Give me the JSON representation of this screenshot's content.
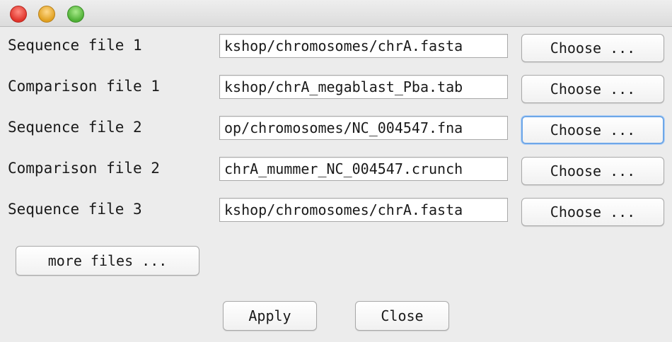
{
  "window": {
    "controls": [
      "close",
      "minimize",
      "zoom"
    ]
  },
  "rows": [
    {
      "label": "Sequence file 1",
      "path": "kshop/chromosomes/chrA.fasta",
      "button": "Choose ..."
    },
    {
      "label": "Comparison file 1",
      "path": "kshop/chrA_megablast_Pba.tab",
      "button": "Choose ..."
    },
    {
      "label": "Sequence file 2",
      "path": "op/chromosomes/NC_004547.fna",
      "button": "Choose ...",
      "focused": true
    },
    {
      "label": "Comparison file 2",
      "path": "chrA_mummer_NC_004547.crunch",
      "button": "Choose ..."
    },
    {
      "label": "Sequence file 3",
      "path": "kshop/chromosomes/chrA.fasta",
      "button": "Choose ..."
    }
  ],
  "actions": {
    "more_files": "more files ...",
    "apply": "Apply",
    "close": "Close"
  },
  "colors": {
    "window_bg": "#ececec",
    "focus_ring": "#6ea7e8",
    "close_light": "#e0342b",
    "minimize_light": "#e0a020",
    "zoom_light": "#4fb035"
  }
}
